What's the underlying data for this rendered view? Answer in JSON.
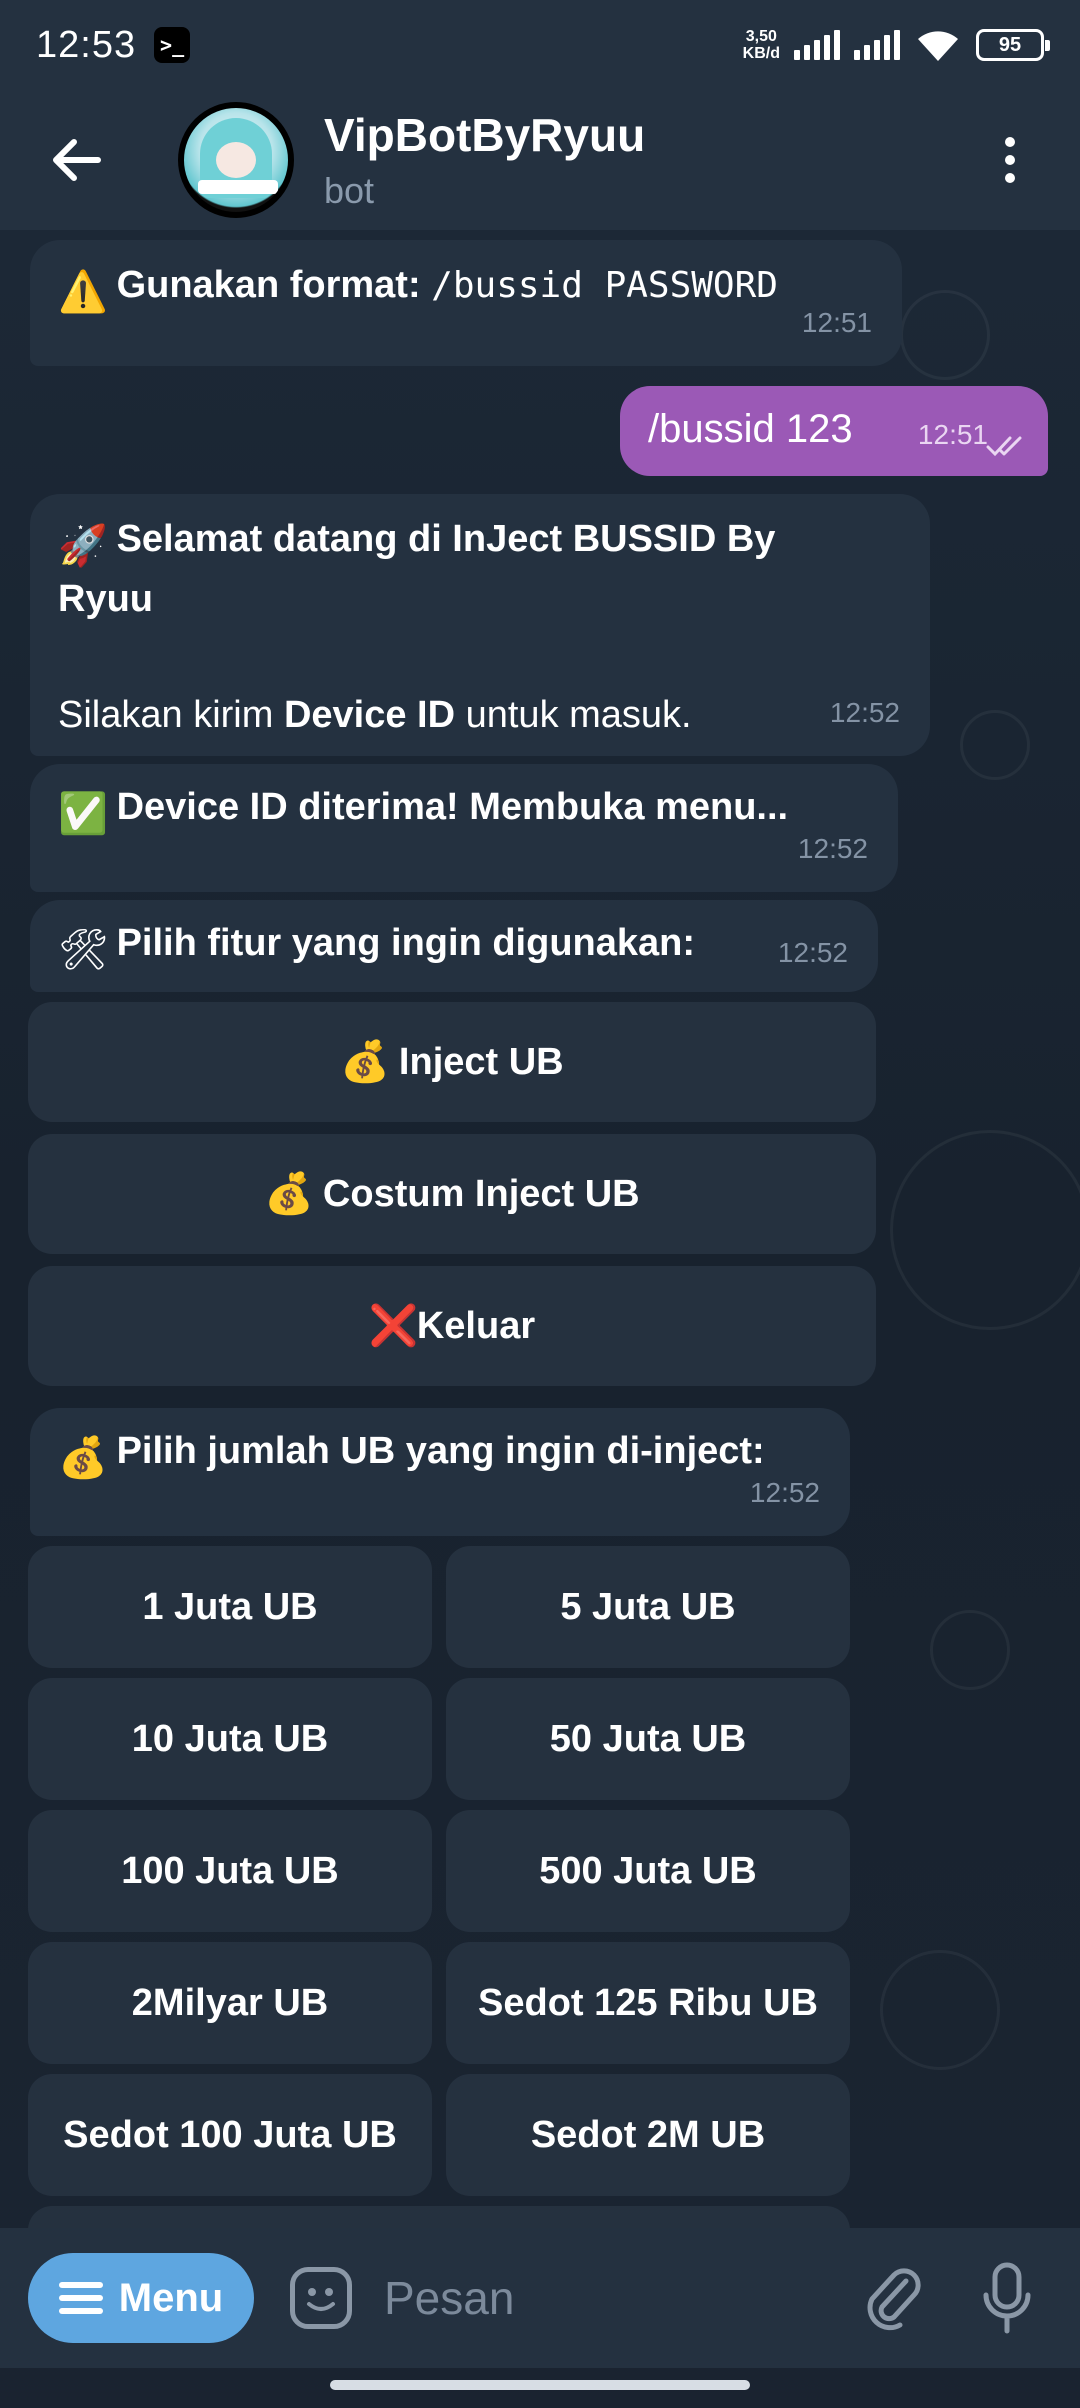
{
  "status_bar": {
    "time": "12:53",
    "terminal_glyph": ">_",
    "net_speed_value": "3,50",
    "net_speed_unit": "KB/d",
    "battery": "95"
  },
  "header": {
    "title": "VipBotByRyuu",
    "subtitle": "bot"
  },
  "messages": {
    "m1": {
      "emoji": "⚠️",
      "text": "Gunakan format: ",
      "code": "/bussid PASSWORD",
      "time": "12:51"
    },
    "m2": {
      "text": "/bussid 123",
      "time": "12:51"
    },
    "m3": {
      "emoji": "🚀",
      "line1": "Selamat datang di InJect BUSSID By",
      "line2": "Ryuu",
      "pre": "Silakan kirim ",
      "bold": "Device ID",
      "post": " untuk masuk.",
      "time": "12:52"
    },
    "m4": {
      "emoji": "✅",
      "text": "Device ID diterima! Membuka menu...",
      "time": "12:52"
    },
    "m5": {
      "emoji": "🛠",
      "text": "Pilih fitur yang ingin digunakan:",
      "time": "12:52"
    },
    "m6": {
      "emoji": "💰",
      "text": "Pilih jumlah UB yang ingin di-inject:",
      "time": "12:52"
    }
  },
  "menu_buttons": {
    "inject": {
      "emoji": "💰",
      "label": "Inject UB"
    },
    "custom": {
      "emoji": "💰",
      "label": "Costum Inject UB"
    },
    "exit": {
      "emoji": "❌",
      "label": "Keluar"
    }
  },
  "amount_buttons": {
    "b1": "1 Juta UB",
    "b2": "5 Juta UB",
    "b3": "10 Juta UB",
    "b4": "50 Juta UB",
    "b5": "100 Juta UB",
    "b6": "500 Juta UB",
    "b7": "2Milyar UB",
    "b8": "Sedot 125 Ribu UB",
    "b9": "Sedot 100 Juta UB",
    "b10": "Sedot 2M UB"
  },
  "input_bar": {
    "menu_label": "Menu",
    "placeholder": "Pesan"
  },
  "colors": {
    "header_bg": "#243140",
    "bubble_in": "#243140",
    "bubble_out": "#9b59b6",
    "menu_button": "#5ea6e0"
  }
}
